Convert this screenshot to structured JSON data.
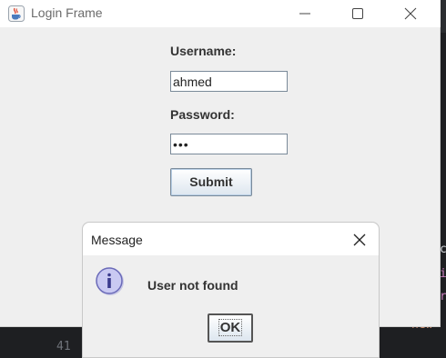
{
  "login_window": {
    "title": "Login Frame",
    "username_label": "Username:",
    "username_value": "ahmed",
    "password_label": "Password:",
    "password_masked": "•••",
    "submit_label": "Submit"
  },
  "message_dialog": {
    "title": "Message",
    "message": "User not found",
    "ok_label": "OK"
  },
  "background_editor": {
    "top_fragment": "o",
    "line_number": "41",
    "fragments": [
      "c",
      "i",
      "r",
      "new"
    ]
  },
  "icons": {
    "app": "java-coffee-icon",
    "minimize": "minimize-icon",
    "maximize": "maximize-icon",
    "close": "close-icon",
    "info": "info-icon"
  },
  "colors": {
    "window_bg": "#efefef",
    "titlebar_bg": "#ffffff",
    "editor_bg": "#1e1f22",
    "info_icon_fill": "#c9c9f2",
    "info_icon_stroke": "#6a6ab8"
  }
}
